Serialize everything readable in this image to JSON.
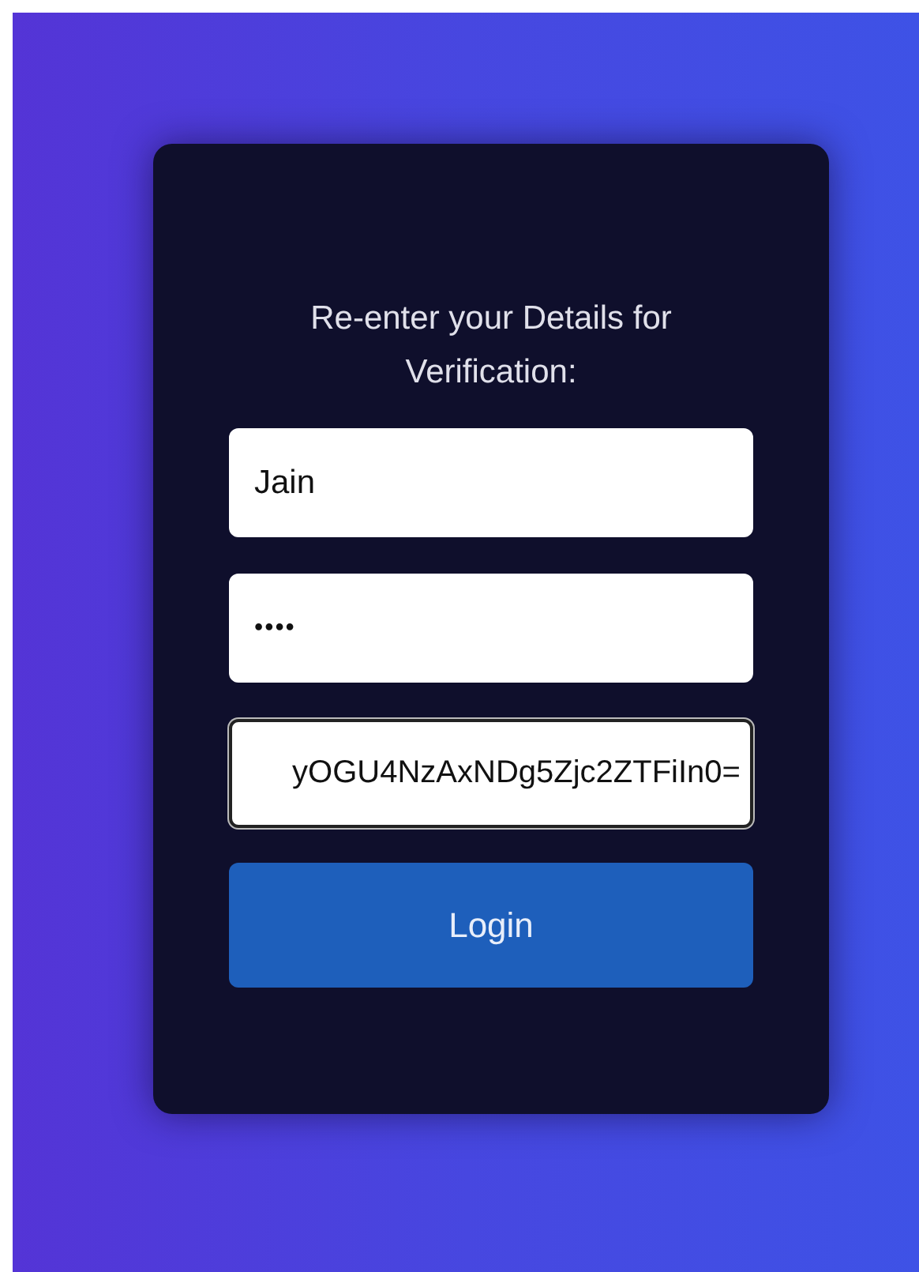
{
  "heading": "Re-enter your Details for Verification:",
  "fields": [
    {
      "kind": "text",
      "value": "Jain",
      "focused": false
    },
    {
      "kind": "password",
      "value": "••••",
      "focused": false
    },
    {
      "kind": "text",
      "value": "yOGU4NzAxNDg5Zjc2ZTFiIn0=",
      "focused": true
    }
  ],
  "button": {
    "label": "Login"
  }
}
